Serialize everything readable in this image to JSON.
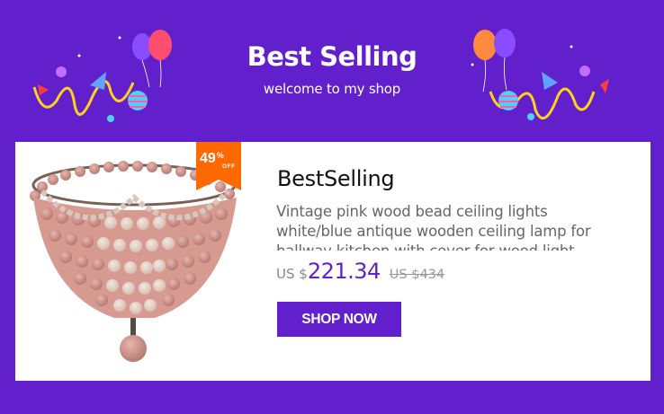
{
  "banner": {
    "title": "Best Selling",
    "subtitle": "welcome to my shop"
  },
  "product": {
    "discount_percent": "49",
    "discount_symbol": "%",
    "discount_off": "OFF",
    "brand_name": "BestSelling",
    "description": "Vintage pink wood bead ceiling lights white/blue antique wooden ceiling lamp for hallway kitchen with cover for wood light fixture",
    "price_currency": "US $",
    "price": "221.34",
    "old_price": "US $434",
    "button_label": "SHOP NOW"
  },
  "colors": {
    "background": "#6120cc",
    "accent": "#6120cc",
    "discount_tag": "#ff6a00"
  },
  "icons": [
    "balloon-icon",
    "party-decoration-icon",
    "discount-badge-icon",
    "chandelier-product-image"
  ]
}
